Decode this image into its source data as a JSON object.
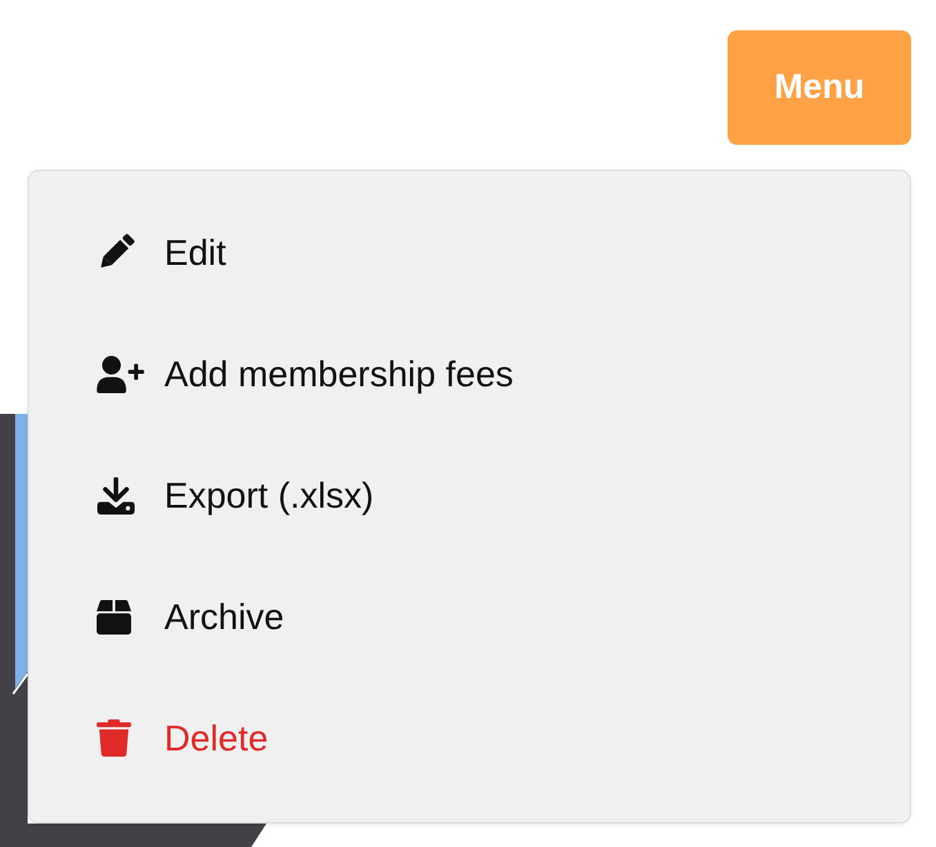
{
  "menu_button": {
    "label": "Menu",
    "expanded": true
  },
  "dropdown": {
    "items": [
      {
        "label": "Edit",
        "kind": "action"
      },
      {
        "label": "Add membership fees",
        "kind": "action"
      },
      {
        "label": "Export (.xlsx)",
        "kind": "action"
      },
      {
        "label": "Archive",
        "kind": "action"
      },
      {
        "label": "Delete",
        "kind": "danger"
      }
    ]
  }
}
